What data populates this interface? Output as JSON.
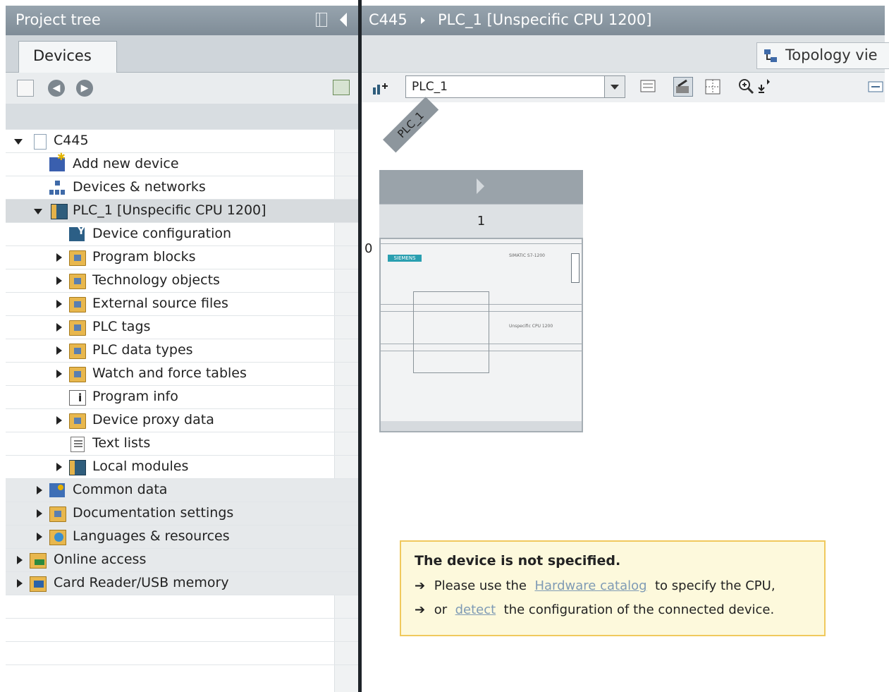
{
  "project_tree": {
    "title": "Project tree",
    "tab": "Devices",
    "items": [
      {
        "label": "C445"
      },
      {
        "label": "Add new device"
      },
      {
        "label": "Devices & networks"
      },
      {
        "label": "PLC_1 [Unspecific CPU 1200]"
      },
      {
        "label": "Device configuration"
      },
      {
        "label": "Program blocks"
      },
      {
        "label": "Technology objects"
      },
      {
        "label": "External source files"
      },
      {
        "label": "PLC tags"
      },
      {
        "label": "PLC data types"
      },
      {
        "label": "Watch and force tables"
      },
      {
        "label": "Program info"
      },
      {
        "label": "Device proxy data"
      },
      {
        "label": "Text lists"
      },
      {
        "label": "Local modules"
      },
      {
        "label": "Common data"
      },
      {
        "label": "Documentation settings"
      },
      {
        "label": "Languages & resources"
      },
      {
        "label": "Online access"
      },
      {
        "label": "Card Reader/USB memory"
      }
    ]
  },
  "editor": {
    "breadcrumb": [
      "C445",
      "PLC_1 [Unspecific CPU 1200]"
    ],
    "view_button": "Topology vie",
    "device_select": "PLC_1",
    "device_label": "PLC_1",
    "slot_number": "1",
    "rack_index": "0",
    "cpu_brand": "SIEMENS",
    "cpu_model": "SIMATIC S7-1200",
    "cpu_type": "Unspecific CPU 1200"
  },
  "notice": {
    "heading": "The device is not specified.",
    "line1_prefix": "Please use the",
    "line1_link": "Hardware catalog",
    "line1_suffix": "to specify the CPU,",
    "line2_prefix": "or",
    "line2_link": "detect",
    "line2_suffix": "the configuration of the connected device."
  }
}
